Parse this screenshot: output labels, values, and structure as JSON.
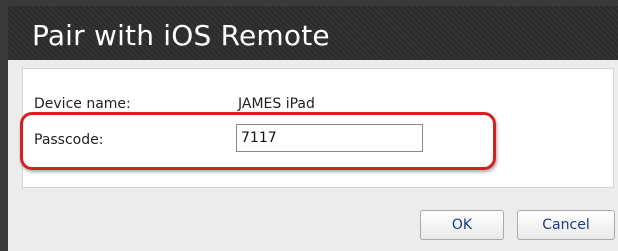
{
  "dialog": {
    "title": "Pair with iOS Remote",
    "device_name_label": "Device name:",
    "device_name_value": "JAMES iPad",
    "passcode_label": "Passcode:",
    "passcode_value": "7117"
  },
  "buttons": {
    "ok_label": "OK",
    "cancel_label": "Cancel"
  },
  "colors": {
    "highlight": "#d42020",
    "titlebar": "#2b2b2b",
    "button_text": "#1a3a8a"
  }
}
